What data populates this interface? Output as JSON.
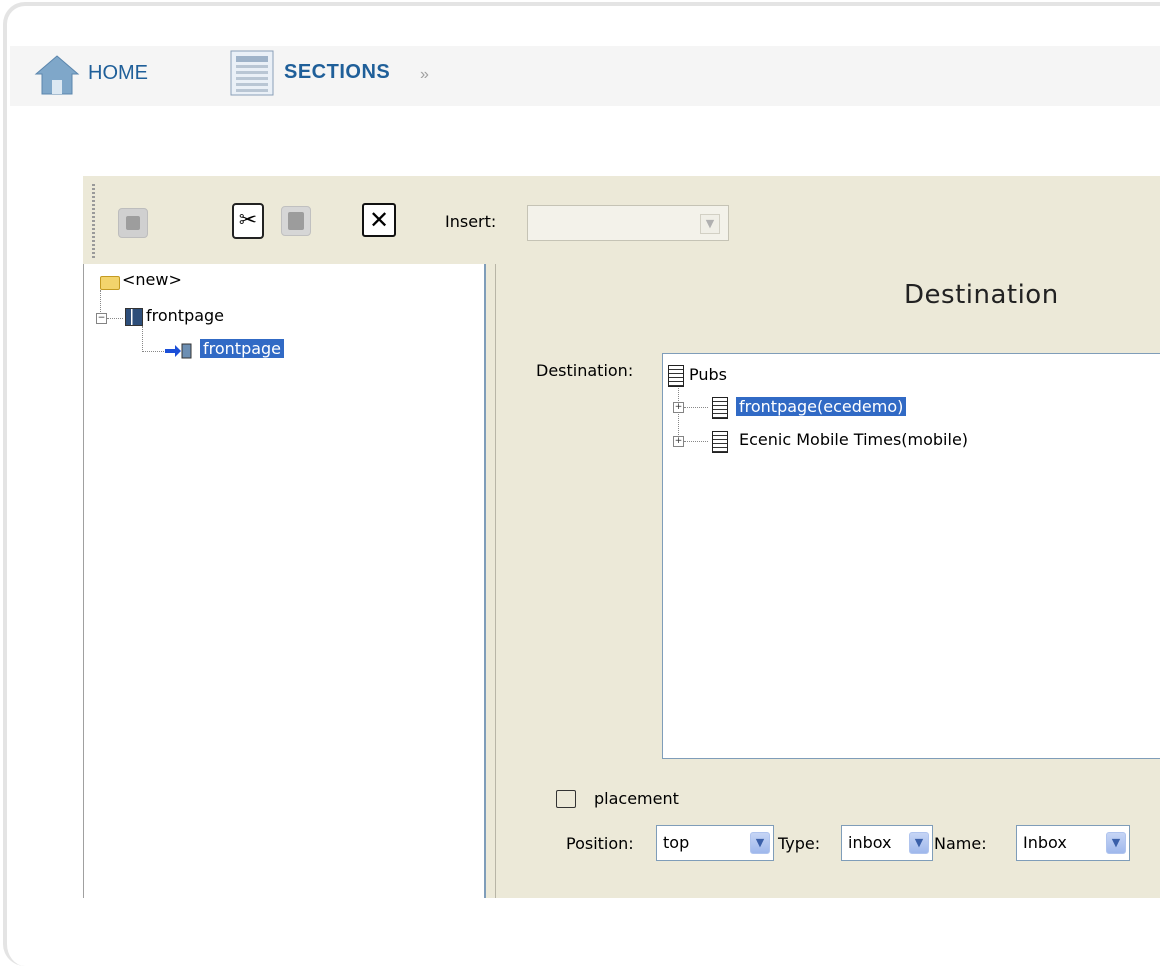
{
  "nav": {
    "home_label": "HOME",
    "sections_label": "SECTIONS",
    "chevron": "»"
  },
  "toolbar": {
    "save_icon": "save-icon",
    "cut_icon": "scissors-icon",
    "paste_icon": "paste-icon",
    "delete_icon": "delete-x-icon",
    "insert_label": "Insert:",
    "insert_value": ""
  },
  "tree": {
    "root_label": "<new>",
    "items": [
      {
        "label": "frontpage",
        "icon": "section-icon",
        "expanded": true
      },
      {
        "label": "frontpage",
        "icon": "placement-arrow-icon",
        "selected": true
      }
    ]
  },
  "destination": {
    "title": "Destination",
    "field_label": "Destination:",
    "items": [
      {
        "label": "Pubs"
      },
      {
        "label": "frontpage(ecedemo)",
        "selected": true,
        "expander": "+"
      },
      {
        "label": "Ecenic Mobile Times(mobile)",
        "expander": "+"
      }
    ]
  },
  "placement": {
    "label": "placement",
    "position_label": "Position:",
    "position_value": "top",
    "type_label": "Type:",
    "type_value": "inbox",
    "name_label": "Name:",
    "name_value": "Inbox"
  },
  "colors": {
    "link_blue": "#1f5f99",
    "selection_blue": "#316ac5",
    "panel_beige": "#ece9d8"
  }
}
